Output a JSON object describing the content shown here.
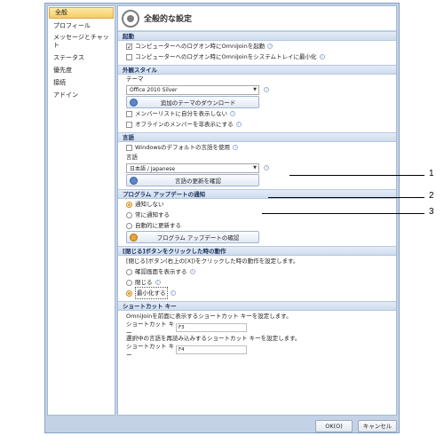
{
  "sidebar": {
    "items": [
      {
        "label": "全般",
        "selected": true
      },
      {
        "label": "プロフィール"
      },
      {
        "label": "メッセージとチャット"
      },
      {
        "label": "ステータス"
      },
      {
        "label": "優先度"
      },
      {
        "label": "接続"
      },
      {
        "label": "アドイン"
      }
    ]
  },
  "header": {
    "title": "全般的な設定",
    "icon": "gear-icon"
  },
  "startup": {
    "title": "起動",
    "opt1": {
      "label": "コンピューターへのログオン時にOmniJoinを起動",
      "checked": true
    },
    "opt2": {
      "label": "コンピューターへのログオン時にOmniJoinをシステムトレイに最小化",
      "checked": false
    }
  },
  "appearance": {
    "title": "外観スタイル",
    "theme_label": "テーマ",
    "theme_value": "Office 2010 Silver",
    "download_button": "追加のテーマのダウンロード",
    "opt1": {
      "label": "メンバーリストに自分を表示しない",
      "checked": false
    },
    "opt2": {
      "label": "オフラインのメンバーを非表示にする",
      "checked": false
    }
  },
  "language": {
    "title": "言語",
    "use_default": {
      "label": "Windowsのデフォルトの言語を使用",
      "checked": false
    },
    "lang_label": "言語",
    "lang_value": "日本語 / Japanese",
    "check_button": "言語の更新を確認"
  },
  "update": {
    "title": "プログラム アップデートの通知",
    "opt1": "通知しない",
    "opt2": "常に通知する",
    "opt3": "自動的に更新する",
    "selected": "通知しない",
    "check_button": "プログラム アップデートの確認"
  },
  "close": {
    "title": "[閉じる]ボタンをクリックした時の動作",
    "desc": "[閉じる]ボタン(右上の[X])をクリックした時の動作を設定します。",
    "opt1": "確認画面を表示する",
    "opt2": "閉じる",
    "opt3": "最小化する",
    "selected": "最小化する"
  },
  "shortcut": {
    "title": "ショートカット キー",
    "desc1": "OmniJoinを前面に表示するショートカット キーを設定します。",
    "key_label1": "ショートカット キー",
    "key_value1": "F3",
    "desc2": "選択中の言語を再読み込みするショートカット キーを設定します。",
    "key_label2": "ショートカット キー",
    "key_value2": "F4"
  },
  "footer": {
    "ok": "OK(O)",
    "cancel": "キャンセル"
  },
  "callouts": [
    "1",
    "2",
    "3"
  ],
  "colors": {
    "accent": "#1a2f5a",
    "selection": "#f8cc62",
    "window": "#c3d2e6"
  }
}
